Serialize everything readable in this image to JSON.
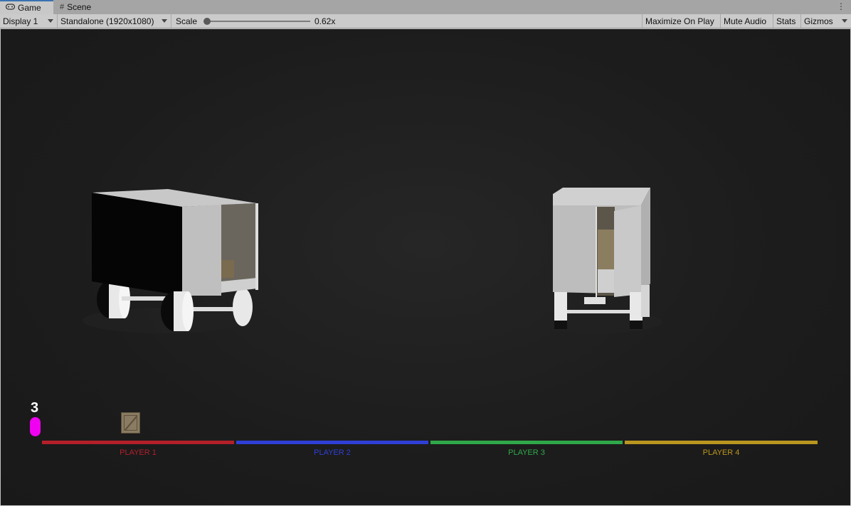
{
  "tabs": [
    {
      "label": "Game",
      "icon": "gamepad-icon",
      "active": true
    },
    {
      "label": "Scene",
      "icon": "grid-icon",
      "active": false
    }
  ],
  "tab_menu_icon": "kebab-menu-icon",
  "toolbar": {
    "display": "Display 1",
    "resolution": "Standalone (1920x1080)",
    "scale_label": "Scale",
    "scale_value": "0.62x",
    "maximize_on_play": "Maximize On Play",
    "mute_audio": "Mute Audio",
    "stats": "Stats",
    "gizmos": "Gizmos"
  },
  "hud": {
    "counter": "3",
    "players": [
      {
        "label": "PLAYER 1",
        "color": "#b3202a"
      },
      {
        "label": "PLAYER 2",
        "color": "#2f3fd6"
      },
      {
        "label": "PLAYER 3",
        "color": "#2fa84a"
      },
      {
        "label": "PLAYER 4",
        "color": "#b9961f"
      }
    ]
  },
  "colors": {
    "capsule": "#f000f0",
    "viewport_bg": "#1d1d1d",
    "tab_accent": "#3a72b0"
  }
}
